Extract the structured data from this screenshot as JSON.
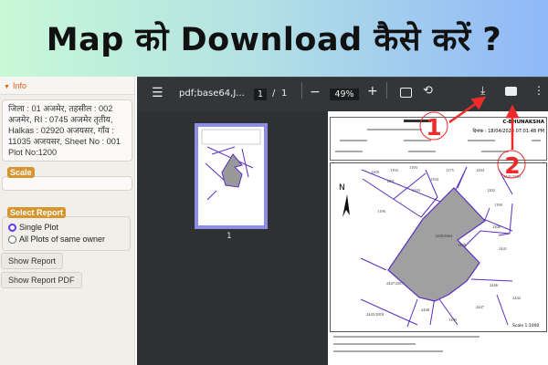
{
  "banner": {
    "title": "Map को Download कैसे करें ?"
  },
  "left_panel": {
    "info_header": "Info",
    "info_lines": [
      "जिला : 01 अजमेर, तहसील : 002",
      "अजमेर, RI : 0745 अजमेर तृतीय,",
      "Halkas : 02920 अजयसर, गाँव :",
      "11035 अजयसर, Sheet No : 001",
      "Plot No:1200"
    ],
    "scale_label": "Scale",
    "scale_value": "",
    "select_report_label": "Select Report",
    "options": [
      {
        "label": "Single Plot",
        "selected": true
      },
      {
        "label": "All Plots of same owner",
        "selected": false
      }
    ],
    "show_report": "Show Report",
    "show_report_pdf": "Show Report PDF"
  },
  "viewer": {
    "filename": "pdf;base64,J...",
    "page_current": "1",
    "page_sep": "/",
    "page_total": "1",
    "zoom": "49%",
    "thumb_page": "1",
    "accent": "#8d8de8"
  },
  "annotations": {
    "one": "1",
    "two": "2",
    "color": "#ee2a2a"
  },
  "document": {
    "header_right": "C-BHUNAKSHA",
    "date": "दिनांक : 18/04/2023 07:01:48 PM",
    "scale": "Scale 1:1000",
    "north": "N",
    "parcels": [
      "1205",
      "1192",
      "1193",
      "1175",
      "1204",
      "1201",
      "1194",
      "1202",
      "1203",
      "1196",
      "1199",
      "1200",
      "1200/2604",
      "1198",
      "2441",
      "2447/2817",
      "2446",
      "2447",
      "2442",
      "2448",
      "2445/2818",
      "1189",
      "2441/2603"
    ]
  }
}
